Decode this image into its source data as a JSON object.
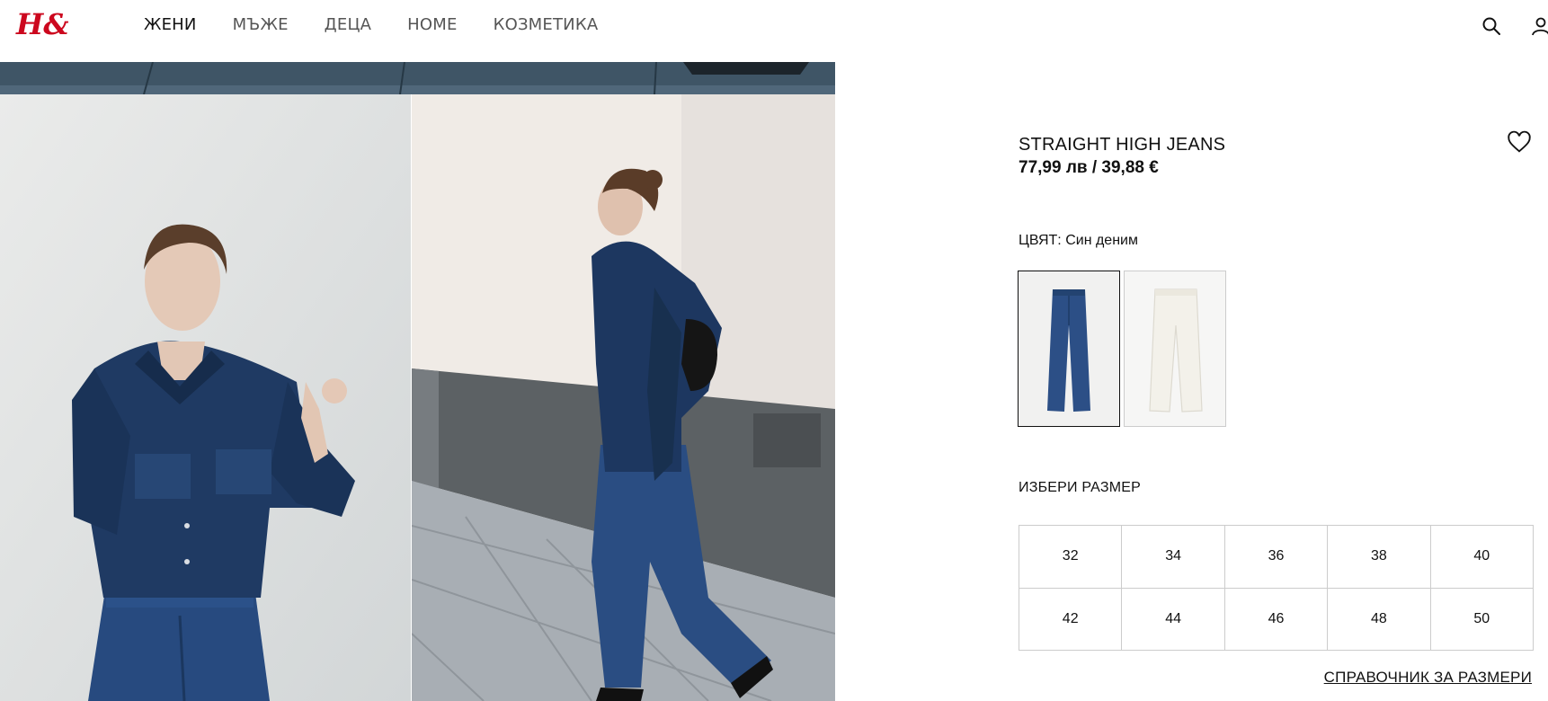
{
  "brand": {
    "logo_text": "H&M",
    "color": "#cc071e"
  },
  "nav": {
    "items": [
      {
        "label": "ЖЕНИ",
        "active": true
      },
      {
        "label": "МЪЖЕ",
        "active": false
      },
      {
        "label": "ДЕЦА",
        "active": false
      },
      {
        "label": "HOME",
        "active": false
      },
      {
        "label": "КОЗМЕТИКА",
        "active": false
      }
    ]
  },
  "header_icons": [
    "search-icon",
    "account-icon"
  ],
  "product": {
    "name": "STRAIGHT HIGH JEANS",
    "price": "77,99 лв / 39,88 €",
    "color_label": "ЦВЯТ: Син деним",
    "swatches": [
      {
        "name": "denim-blue",
        "color": "#2c4f86",
        "selected": true
      },
      {
        "name": "white",
        "color": "#f3f1ea",
        "selected": false
      }
    ],
    "size_label": "ИЗБЕРИ РАЗМЕР",
    "sizes": [
      "32",
      "34",
      "36",
      "38",
      "40",
      "42",
      "44",
      "46",
      "48",
      "50"
    ],
    "size_guide": "СПРАВОЧНИК ЗА РАЗМЕРИ"
  }
}
